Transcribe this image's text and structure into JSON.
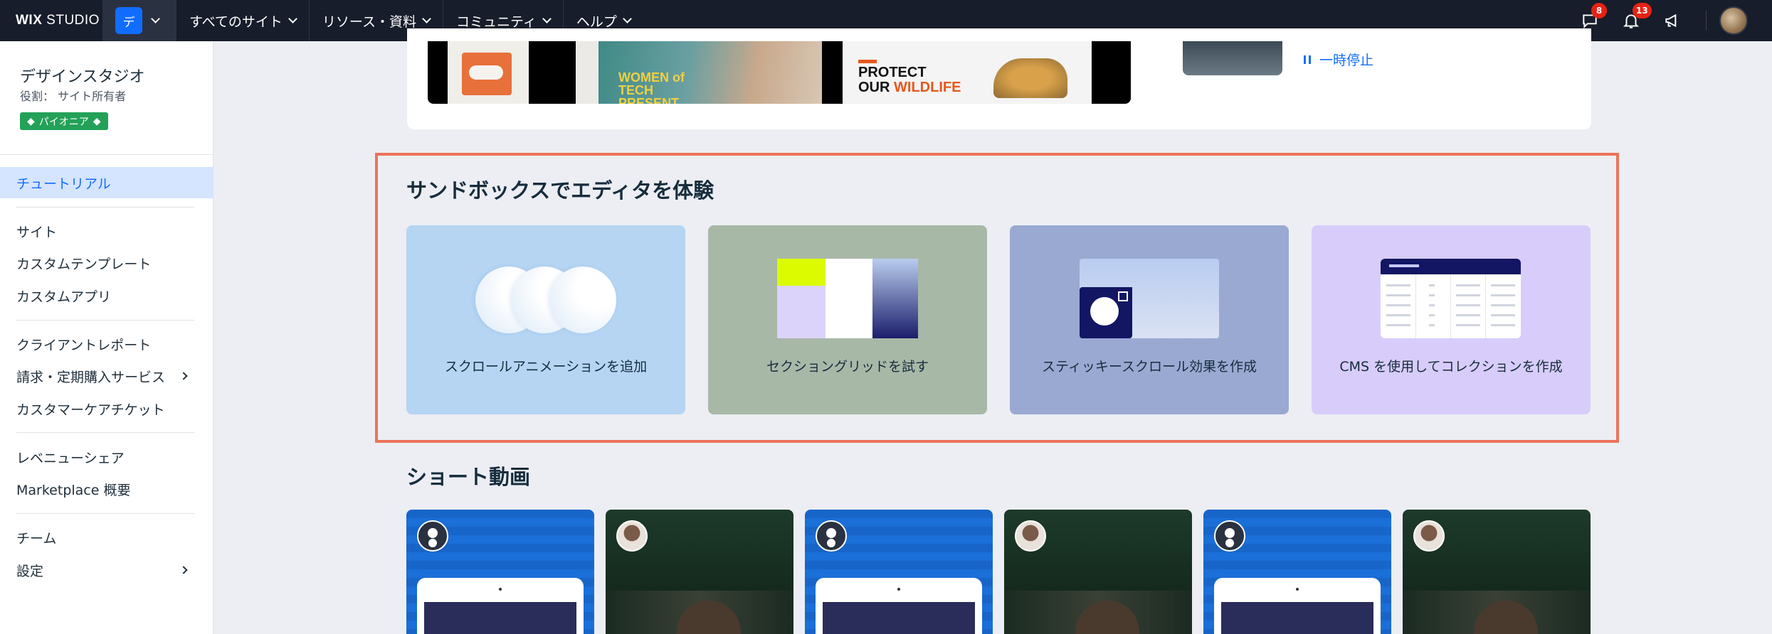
{
  "topbar": {
    "logo_wix": "WIX",
    "logo_studio": "STUDIO",
    "site_badge": "デ",
    "nav": [
      "すべてのサイト",
      "リソース・資料",
      "コミュニティ",
      "ヘルプ"
    ],
    "icons": [
      "chat-icon",
      "bell-icon",
      "megaphone-icon"
    ],
    "chat_count": "8",
    "notification_count": "13"
  },
  "sidebar": {
    "workspace_title": "デザインスタジオ",
    "role": "役割： サイト所有者",
    "plan_badge": "パイオニア",
    "items": [
      "チュートリアル",
      "サイト",
      "カスタムテンプレート",
      "カスタムアプリ",
      "クライアントレポート",
      "請求・定期購入サービス",
      "カスタマーケアチケット",
      "レベニューシェア",
      "Marketplace 概要",
      "チーム",
      "設定"
    ]
  },
  "top_section": {
    "pause_label": "一時停止",
    "thumb_women": "WOMEN of TECH PRESENT",
    "thumb_protect_1": "PROTECT",
    "thumb_protect_our": "OUR",
    "thumb_protect_wild": "WILDLIFE"
  },
  "sandbox": {
    "title": "サンドボックスでエディタを体験",
    "cards": [
      {
        "label": "スクロールアニメーションを追加",
        "bg": "#b5d5f3"
      },
      {
        "label": "セクショングリッドを試す",
        "bg": "#a8b8a7"
      },
      {
        "label": "スティッキースクロール効果を作成",
        "bg": "#9aa9d2"
      },
      {
        "label": "CMS を使用してコレクションを作成",
        "bg": "#d8ccfb"
      }
    ]
  },
  "shorts": {
    "title": "ショート動画"
  },
  "colors": {
    "accent": "#116dff",
    "highlight_border": "#ec7358",
    "topbar": "#171d2a",
    "badge_green": "#23a158"
  }
}
